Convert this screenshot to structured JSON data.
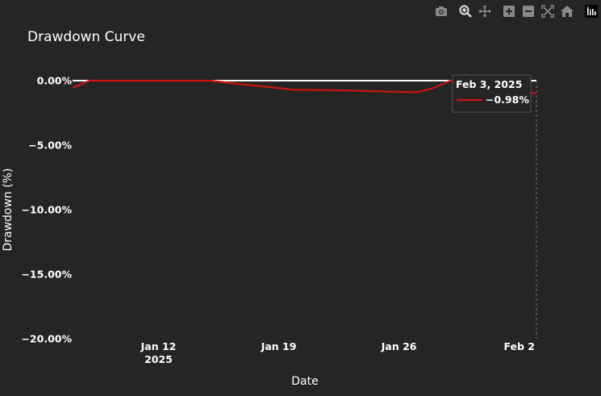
{
  "modebar": {
    "buttons": [
      "camera-icon",
      "zoom-icon",
      "pan-icon",
      "zoom-in-icon",
      "zoom-out-icon",
      "autoscale-icon",
      "home-icon",
      "plotly-logo-icon"
    ]
  },
  "chart_data": {
    "type": "line",
    "title": "Drawdown Curve",
    "xlabel": "Date",
    "ylabel": "Drawdown (%)",
    "xlim": [
      "2025-01-07",
      "2025-02-03"
    ],
    "ylim": [
      -20,
      0
    ],
    "y_ticks": [
      0,
      -5,
      -10,
      -15,
      -20
    ],
    "y_tick_labels": [
      "0.00%",
      "−5.00%",
      "−10.00%",
      "−15.00%",
      "−20.00%"
    ],
    "x_ticks": [
      "2025-01-12",
      "2025-01-19",
      "2025-01-26",
      "2025-02-02"
    ],
    "x_tick_labels": [
      "Jan 12",
      "Jan 19",
      "Jan 26",
      "Feb 2"
    ],
    "x_tick_sublabel": "2025",
    "grid": false,
    "zero_line": true,
    "colors": {
      "series": "#cc1414",
      "background": "#252525",
      "zeroline": "#ffffff"
    },
    "series": [
      {
        "x": [
          "2025-01-07",
          "2025-01-08",
          "2025-01-09",
          "2025-01-10",
          "2025-01-13",
          "2025-01-14",
          "2025-01-15",
          "2025-01-16",
          "2025-01-17",
          "2025-01-20",
          "2025-01-21",
          "2025-01-22",
          "2025-01-23",
          "2025-01-24",
          "2025-01-27",
          "2025-01-28",
          "2025-01-29",
          "2025-01-30",
          "2025-01-31",
          "2025-02-03"
        ],
        "y": [
          -0.55,
          0.0,
          0.0,
          0.0,
          0.0,
          0.0,
          0.0,
          -0.15,
          -0.3,
          -0.72,
          -0.72,
          -0.74,
          -0.76,
          -0.8,
          -0.9,
          -0.58,
          0.0,
          0.0,
          -0.62,
          -0.98
        ]
      }
    ],
    "hover": {
      "date": "Feb 3, 2025",
      "value": "−0.98%"
    }
  }
}
